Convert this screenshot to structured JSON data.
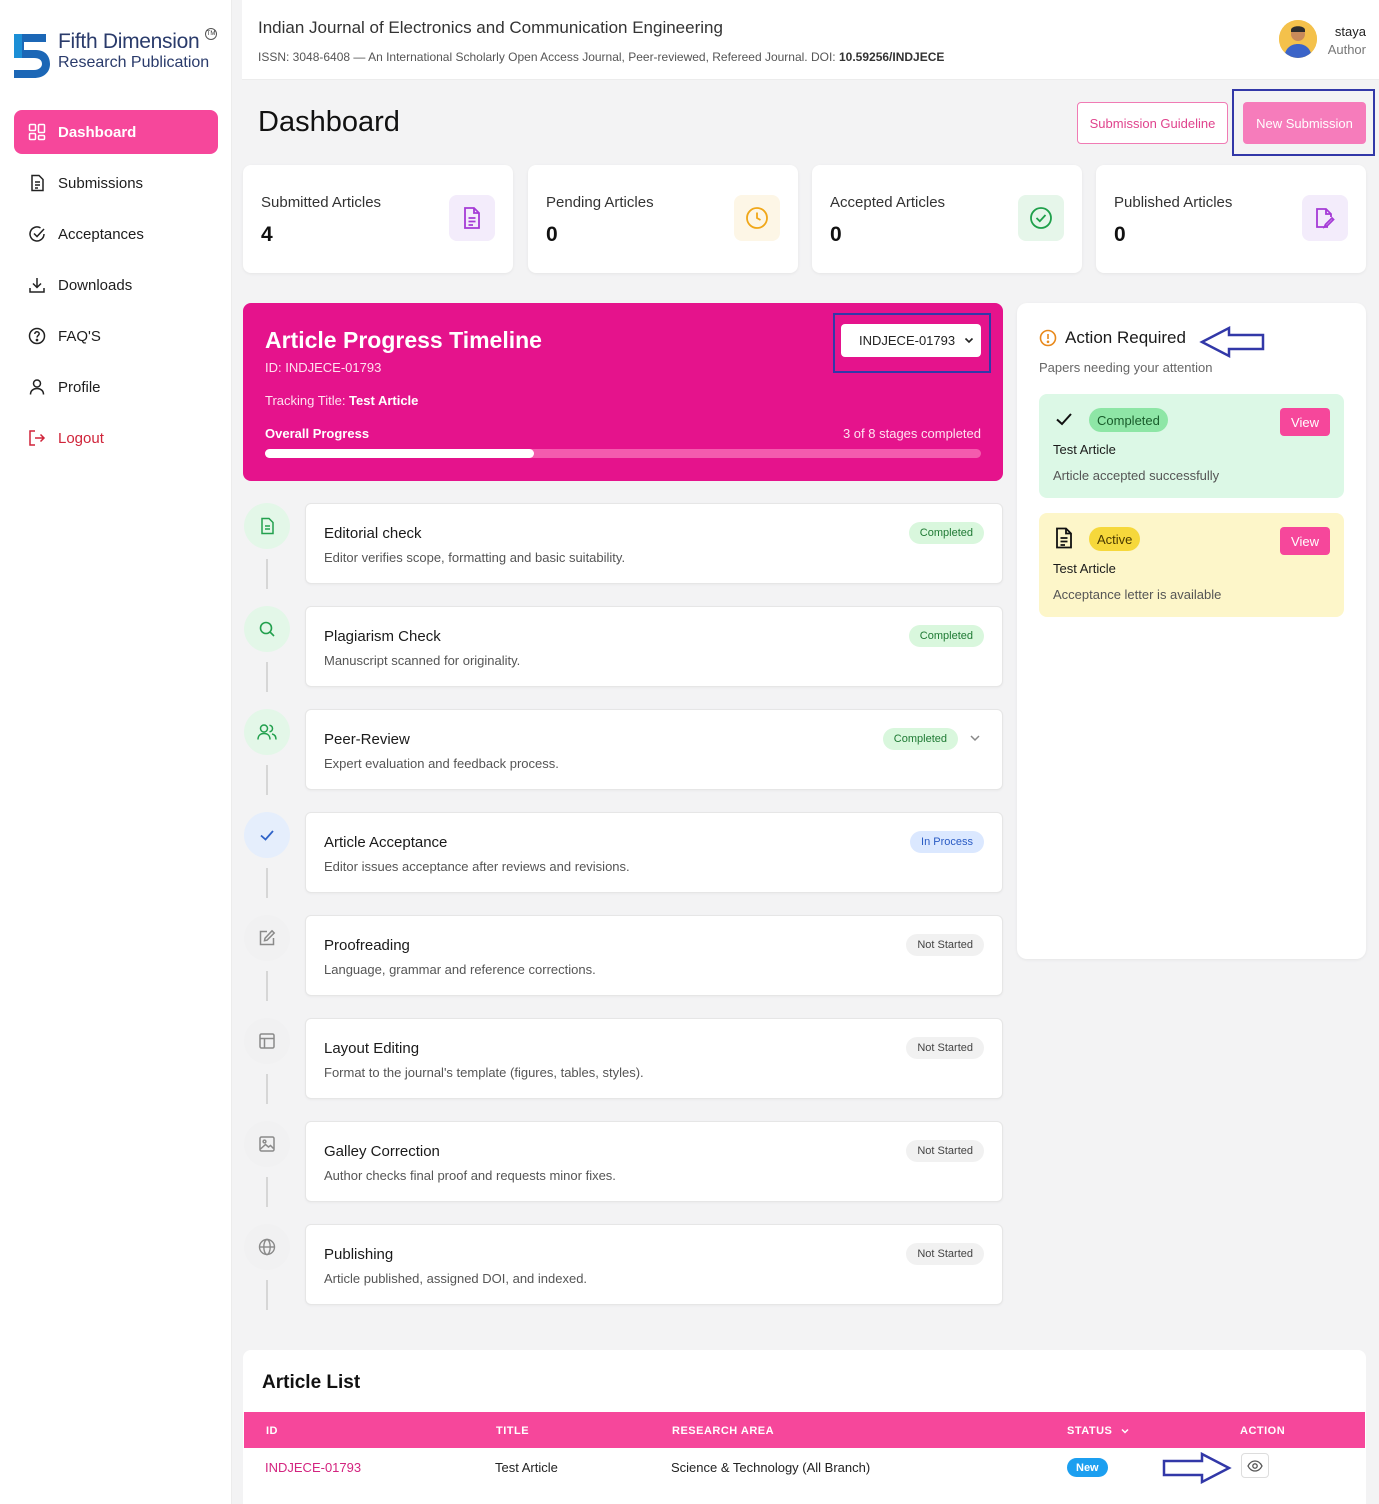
{
  "logo": {
    "title": "Fifth Dimension",
    "subtitle": "Research Publication",
    "tm": "TM"
  },
  "sidebar": {
    "items": [
      {
        "label": "Dashboard",
        "icon": "dashboard-grid-icon"
      },
      {
        "label": "Submissions",
        "icon": "document-icon"
      },
      {
        "label": "Acceptances",
        "icon": "check-circle-icon"
      },
      {
        "label": "Downloads",
        "icon": "download-icon"
      },
      {
        "label": "FAQ'S",
        "icon": "help-circle-icon"
      },
      {
        "label": "Profile",
        "icon": "user-icon"
      },
      {
        "label": "Logout",
        "icon": "logout-icon"
      }
    ]
  },
  "header": {
    "journal_title": "Indian Journal of Electronics and Communication Engineering",
    "journal_sub_prefix": "ISSN: 3048-6408 — An International Scholarly Open Access Journal, Peer-reviewed, Refereed Journal. DOI: ",
    "journal_doi": "10.59256/INDJECE",
    "user_name": "staya",
    "user_role": "Author"
  },
  "page": {
    "title": "Dashboard",
    "guideline_button": "Submission Guideline",
    "new_submission_button": "New Submission"
  },
  "stats": [
    {
      "label": "Submitted Articles",
      "value": "4",
      "icon": "document-icon",
      "color": "#a53bd6",
      "bg": "#f3ecfb"
    },
    {
      "label": "Pending Articles",
      "value": "0",
      "icon": "clock-icon",
      "color": "#f0a719",
      "bg": "#fdf6e6"
    },
    {
      "label": "Accepted Articles",
      "value": "0",
      "icon": "check-circle-icon",
      "color": "#1fa04b",
      "bg": "#e6f6ea"
    },
    {
      "label": "Published Articles",
      "value": "0",
      "icon": "edit-document-icon",
      "color": "#a53bd6",
      "bg": "#f3ecfb"
    }
  ],
  "timeline": {
    "title": "Article Progress Timeline",
    "id_text": "ID: INDJECE-01793",
    "tracking_label": "Tracking Title: ",
    "tracking_title": "Test Article",
    "overall_label": "Overall Progress",
    "count_text": "3 of 8 stages completed",
    "progress_fraction": 0.375,
    "selected_article": "INDJECE-01793"
  },
  "stages": [
    {
      "name": "Editorial check",
      "desc": "Editor verifies scope, formatting and basic suitability.",
      "status": "Completed",
      "kind": "completed",
      "icon": "document-icon",
      "expandable": false
    },
    {
      "name": "Plagiarism Check",
      "desc": "Manuscript scanned for originality.",
      "status": "Completed",
      "kind": "completed",
      "icon": "search-icon",
      "expandable": false
    },
    {
      "name": "Peer-Review",
      "desc": "Expert evaluation and feedback process.",
      "status": "Completed",
      "kind": "completed",
      "icon": "users-icon",
      "expandable": true
    },
    {
      "name": "Article Acceptance",
      "desc": "Editor issues acceptance after reviews and revisions.",
      "status": "In Process",
      "kind": "inprocess",
      "icon": "check-icon",
      "expandable": false
    },
    {
      "name": "Proofreading",
      "desc": "Language, grammar and reference corrections.",
      "status": "Not Started",
      "kind": "notstarted",
      "icon": "edit-icon",
      "expandable": false
    },
    {
      "name": "Layout Editing",
      "desc": "Format to the journal's template (figures, tables, styles).",
      "status": "Not Started",
      "kind": "notstarted",
      "icon": "layout-icon",
      "expandable": false
    },
    {
      "name": "Galley Correction",
      "desc": "Author checks final proof and requests minor fixes.",
      "status": "Not Started",
      "kind": "notstarted",
      "icon": "image-icon",
      "expandable": false
    },
    {
      "name": "Publishing",
      "desc": "Article published, assigned DOI, and indexed.",
      "status": "Not Started",
      "kind": "notstarted",
      "icon": "globe-icon",
      "expandable": false
    }
  ],
  "action_required": {
    "title": "Action Required",
    "subtitle": "Papers needing your attention",
    "cards": [
      {
        "badge": "Completed",
        "article": "Test Article",
        "message": "Article accepted successfully",
        "view_label": "View",
        "icon": "check-icon"
      },
      {
        "badge": "Active",
        "article": "Test Article",
        "message": "Acceptance letter is available",
        "view_label": "View",
        "icon": "document-icon"
      }
    ]
  },
  "article_list": {
    "title": "Article List",
    "columns": [
      "ID",
      "TITLE",
      "RESEARCH AREA",
      "STATUS",
      "ACTION"
    ],
    "rows": [
      {
        "id": "INDJECE-01793",
        "title": "Test Article",
        "area": "Science & Technology (All Branch)",
        "status": "New"
      }
    ]
  },
  "colors": {
    "accent": "#f6479b",
    "timeline_bg": "#e5138c",
    "annotation_blue": "#3238a8"
  }
}
